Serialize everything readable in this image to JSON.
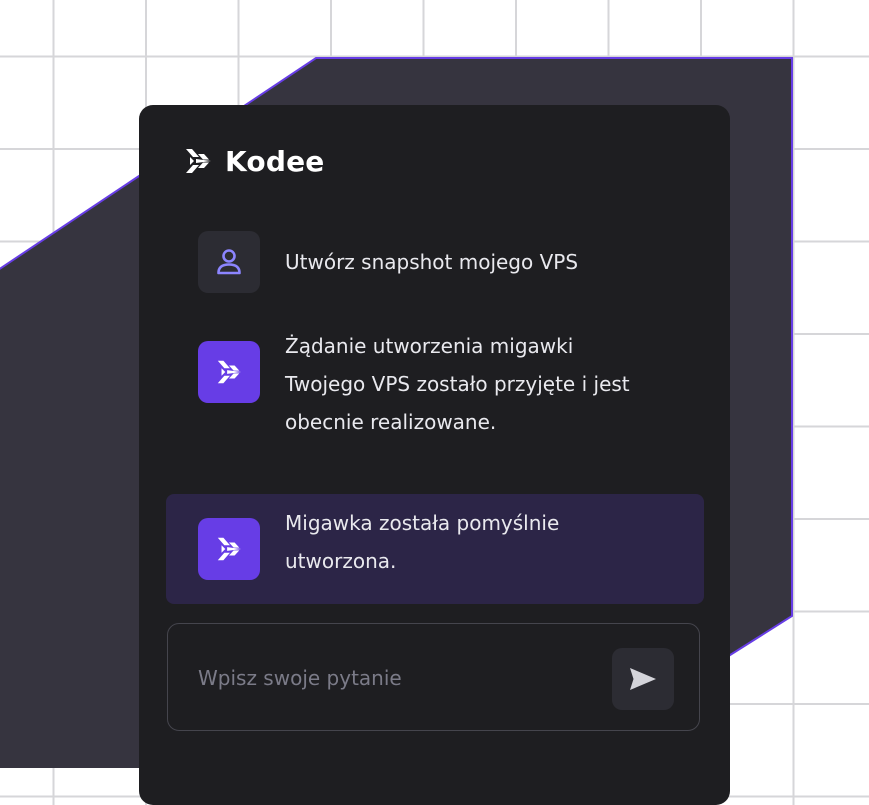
{
  "app": {
    "name": "Kodee"
  },
  "chat": {
    "messages": [
      {
        "role": "user",
        "icon": "user-icon",
        "text": "Utwórz snapshot mojego VPS"
      },
      {
        "role": "assistant",
        "icon": "kodee-logo-icon",
        "text": "Żądanie utworzenia migawki\nTwojego VPS zostało przyjęte i jest\nobecnie realizowane."
      },
      {
        "role": "assistant",
        "icon": "kodee-logo-icon",
        "text": "Migawka została pomyślnie\nutworzona.",
        "highlighted": true
      }
    ]
  },
  "composer": {
    "placeholder": "Wpisz swoje pytanie",
    "value": "",
    "send_icon": "send-icon"
  },
  "colors": {
    "accent": "#673de6",
    "panel_background": "#1e1e21",
    "highlight_background": "#2c2547",
    "backdrop_shape": "#36343f",
    "backdrop_outline": "#673de6"
  }
}
